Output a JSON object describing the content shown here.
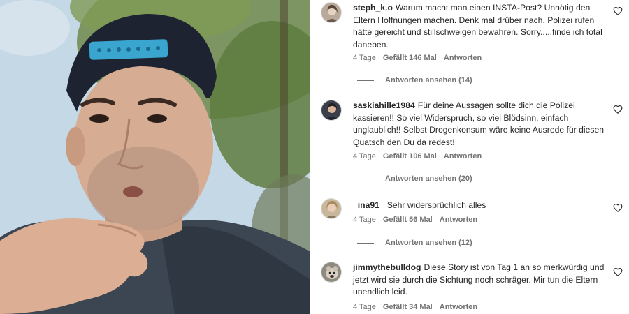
{
  "media": {
    "description_icon": "video-frame"
  },
  "comments": [
    {
      "username": "steph_k.o",
      "text": "Warum macht man einen INSTA-Post? Unnötig den Eltern Hoffnungen machen. Denk mal drüber nach. Polizei rufen hätte gereicht und stillschweigen bewahren. Sorry.....finde ich total daneben.",
      "age": "4 Tage",
      "likes": "Gefällt 146 Mal",
      "reply_label": "Antworten",
      "view_replies": "Antworten ansehen (14)",
      "avatar_color": "#b8a99a"
    },
    {
      "username": "saskiahille1984",
      "text": "Für deine Aussagen sollte dich die Polizei kassieren!! So viel Widerspruch, so viel Blödsinn, einfach unglaublich!! Selbst Drogenkonsum wäre keine Ausrede für diesen Quatsch den Du da redest!",
      "age": "4 Tage",
      "likes": "Gefällt 106 Mal",
      "reply_label": "Antworten",
      "view_replies": "Antworten ansehen (20)",
      "avatar_color": "#3a3f4a"
    },
    {
      "username": "_ina91_",
      "text": "Sehr widersprüchlich alles",
      "age": "4 Tage",
      "likes": "Gefällt 56 Mal",
      "reply_label": "Antworten",
      "view_replies": "Antworten ansehen (12)",
      "avatar_color": "#c9b79c"
    },
    {
      "username": "jimmythebulldog",
      "text": "Diese Story ist von Tag 1 an so merkwürdig und jetzt wird sie durch die Sichtung noch schräger. Mir tun die Eltern unendlich leid.",
      "age": "4 Tage",
      "likes": "Gefällt 34 Mal",
      "reply_label": "Antworten",
      "avatar_color": "#8e8a80"
    }
  ],
  "colors": {
    "text": "#262626",
    "secondary": "#737373"
  }
}
